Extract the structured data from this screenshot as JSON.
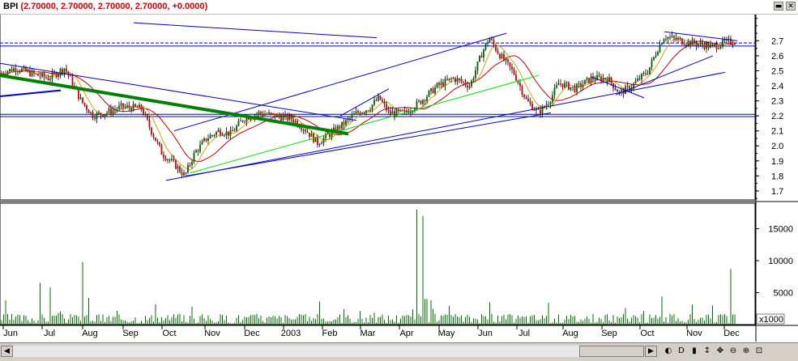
{
  "window": {
    "symbol": "BPI",
    "quote": "(2.70000, 2.70000, 2.70000, 2.70000, +0.0000)",
    "minimize_glyph": "▬",
    "close_glyph": "✕"
  },
  "scrollbar": {
    "left_arrow": "◀",
    "right_arrow": "▶",
    "tools": [
      {
        "name": "zoom-reset-icon",
        "glyph": "◐"
      },
      {
        "name": "daily-period-icon",
        "glyph": "D"
      },
      {
        "name": "chart-type-icon",
        "glyph": "▮"
      },
      {
        "name": "pan-vertical-icon",
        "glyph": "↕"
      },
      {
        "name": "pan-all-icon",
        "glyph": "✥"
      },
      {
        "name": "zoom-out-icon",
        "glyph": "⊖"
      },
      {
        "name": "zoom-in-icon",
        "glyph": "⊕"
      },
      {
        "name": "lock-icon",
        "glyph": "⊡"
      }
    ]
  },
  "chart_data": [
    {
      "type": "candlestick",
      "title": "",
      "xlabel": "",
      "ylabel": "",
      "ylim": [
        1.64,
        2.88
      ],
      "y_ticks": [
        1.7,
        1.8,
        1.9,
        2.0,
        2.1,
        2.2,
        2.3,
        2.4,
        2.5,
        2.6,
        2.7
      ],
      "x_ticks": [
        "Jun",
        "Jul",
        "Aug",
        "Sep",
        "Oct",
        "Nov",
        "Dec",
        "2003",
        "Feb",
        "Mar",
        "Apr",
        "May",
        "Jun",
        "Jul",
        "Aug",
        "Sep",
        "Oct",
        "Nov",
        "Dec"
      ],
      "close_path_keypoints": [
        [
          0,
          2.48
        ],
        [
          20,
          2.52
        ],
        [
          40,
          2.48
        ],
        [
          60,
          2.45
        ],
        [
          80,
          2.52
        ],
        [
          100,
          2.3
        ],
        [
          115,
          2.2
        ],
        [
          130,
          2.22
        ],
        [
          150,
          2.26
        ],
        [
          175,
          2.25
        ],
        [
          185,
          2.12
        ],
        [
          200,
          1.95
        ],
        [
          215,
          1.88
        ],
        [
          228,
          1.8
        ],
        [
          240,
          1.95
        ],
        [
          255,
          2.05
        ],
        [
          270,
          2.1
        ],
        [
          285,
          2.08
        ],
        [
          300,
          2.18
        ],
        [
          320,
          2.22
        ],
        [
          340,
          2.2
        ],
        [
          360,
          2.18
        ],
        [
          375,
          2.12
        ],
        [
          392,
          2.02
        ],
        [
          405,
          2.07
        ],
        [
          425,
          2.15
        ],
        [
          440,
          2.22
        ],
        [
          455,
          2.25
        ],
        [
          468,
          2.32
        ],
        [
          480,
          2.22
        ],
        [
          500,
          2.22
        ],
        [
          520,
          2.3
        ],
        [
          540,
          2.4
        ],
        [
          560,
          2.45
        ],
        [
          580,
          2.4
        ],
        [
          595,
          2.62
        ],
        [
          604,
          2.72
        ],
        [
          615,
          2.62
        ],
        [
          635,
          2.48
        ],
        [
          650,
          2.3
        ],
        [
          665,
          2.22
        ],
        [
          678,
          2.3
        ],
        [
          690,
          2.42
        ],
        [
          710,
          2.38
        ],
        [
          730,
          2.45
        ],
        [
          750,
          2.45
        ],
        [
          765,
          2.35
        ],
        [
          780,
          2.4
        ],
        [
          800,
          2.5
        ],
        [
          812,
          2.65
        ],
        [
          820,
          2.73
        ],
        [
          840,
          2.7
        ],
        [
          860,
          2.68
        ],
        [
          880,
          2.66
        ],
        [
          895,
          2.69
        ],
        [
          910,
          2.7
        ]
      ],
      "trendlines": [
        {
          "color": "#0000c0",
          "points": [
            [
              165,
              2.82
            ],
            [
              465,
              2.72
            ]
          ]
        },
        {
          "color": "#0000c0",
          "points": [
            [
              0,
              2.55
            ],
            [
              440,
              2.17
            ]
          ]
        },
        {
          "color": "#0000c0",
          "points": [
            [
              0,
              2.33
            ],
            [
              75,
              2.37
            ]
          ],
          "width": 2
        },
        {
          "color": "#0000c0",
          "points": [
            [
              205,
              1.77
            ],
            [
              895,
              2.49
            ]
          ]
        },
        {
          "color": "#0000c0",
          "points": [
            [
              230,
              1.8
            ],
            [
              680,
              2.22
            ]
          ]
        },
        {
          "color": "#0000c0",
          "points": [
            [
              215,
              2.1
            ],
            [
              625,
              2.75
            ]
          ]
        },
        {
          "color": "#0000c0",
          "points": [
            [
              420,
              2.2
            ],
            [
              480,
              2.38
            ]
          ]
        },
        {
          "color": "#0000c0",
          "points": [
            [
              730,
              2.46
            ],
            [
              795,
              2.32
            ]
          ]
        },
        {
          "color": "#0000c0",
          "points": [
            [
              760,
              2.34
            ],
            [
              880,
              2.6
            ]
          ]
        },
        {
          "color": "#0000c0",
          "points": [
            [
              820,
              2.76
            ],
            [
              910,
              2.7
            ]
          ]
        },
        {
          "color": "#00e000",
          "points": [
            [
              235,
              1.82
            ],
            [
              665,
              2.47
            ]
          ]
        },
        {
          "color": "#008000",
          "points": [
            [
              0,
              2.47
            ],
            [
              300,
              2.2
            ],
            [
              430,
              2.08
            ]
          ],
          "width": 4
        }
      ],
      "horizontal_lines": [
        {
          "value": 2.21,
          "color": "#0000c0",
          "style": "solid"
        },
        {
          "value": 2.195,
          "color": "#0000c0",
          "style": "solid"
        },
        {
          "value": 2.685,
          "color": "#0000c0",
          "style": "dashed"
        },
        {
          "value": 2.665,
          "color": "#0000c0",
          "style": "solid"
        }
      ]
    },
    {
      "type": "bar",
      "title": "",
      "xlabel": "",
      "ylabel": "x1000",
      "ylim": [
        0,
        19000
      ],
      "y_ticks": [
        5000,
        10000,
        15000
      ],
      "spikes": [
        [
          8,
          3800
        ],
        [
          50,
          6500
        ],
        [
          62,
          5800
        ],
        [
          103,
          9800
        ],
        [
          110,
          4200
        ],
        [
          192,
          3200
        ],
        [
          237,
          2800
        ],
        [
          395,
          3600
        ],
        [
          515,
          18000
        ],
        [
          522,
          17000
        ],
        [
          526,
          4000
        ],
        [
          532,
          3800
        ],
        [
          604,
          3500
        ],
        [
          677,
          3400
        ],
        [
          773,
          2600
        ],
        [
          818,
          4400
        ],
        [
          880,
          3000
        ],
        [
          903,
          8700
        ]
      ]
    }
  ]
}
